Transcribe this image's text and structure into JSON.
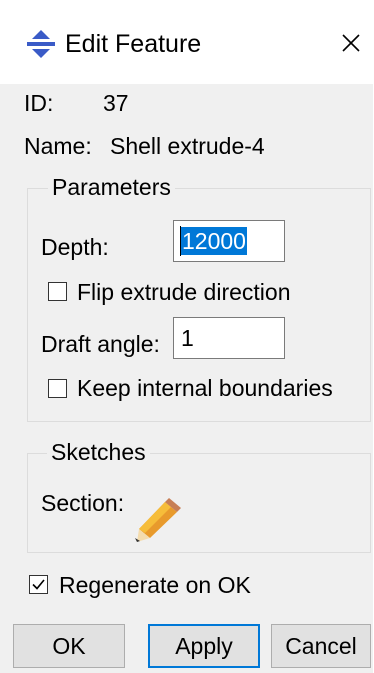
{
  "window": {
    "title": "Edit Feature",
    "close_glyph": "×",
    "icon": "abaqus-arrows-icon"
  },
  "info": {
    "id_label": "ID:",
    "id_value": "37",
    "name_label": "Name:",
    "name_value": "Shell extrude-4"
  },
  "parameters": {
    "group_title": "Parameters",
    "depth_label": "Depth:",
    "depth_value": "12000",
    "flip_label": "Flip extrude direction",
    "flip_checked": false,
    "draft_label": "Draft angle:",
    "draft_value": "1",
    "keep_label": "Keep internal boundaries",
    "keep_checked": false
  },
  "sketches": {
    "group_title": "Sketches",
    "section_label": "Section:",
    "edit_icon": "pencil-icon"
  },
  "regenerate": {
    "label": "Regenerate on OK",
    "checked": true
  },
  "buttons": {
    "ok": "OK",
    "apply": "Apply",
    "cancel": "Cancel"
  },
  "colors": {
    "selection": "#0078d7",
    "dialog_bg": "#f0f0f0",
    "icon_blue": "#3a5bc7"
  }
}
